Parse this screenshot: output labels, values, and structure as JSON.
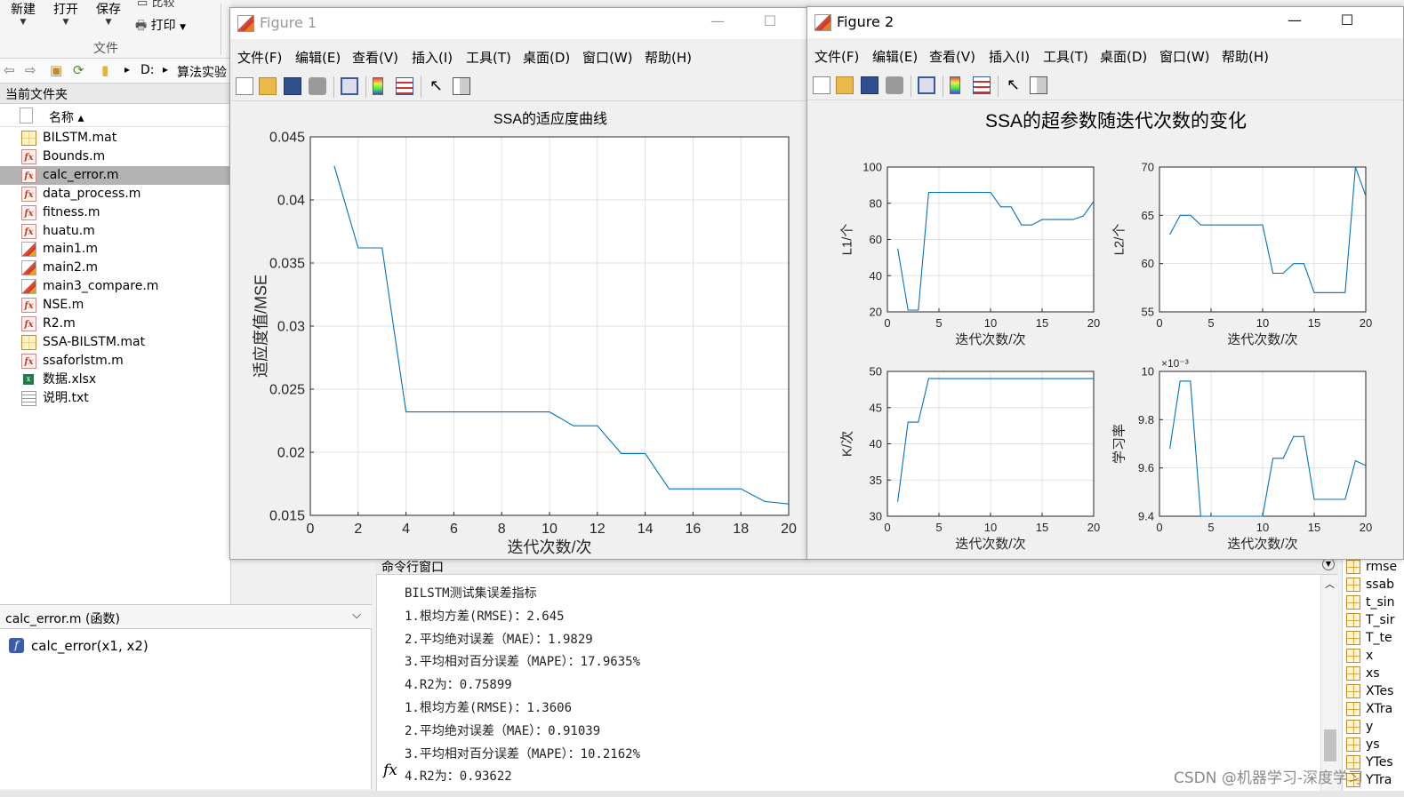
{
  "toolstrip": {
    "new_label": "新建",
    "open_label": "打开",
    "save_label": "保存",
    "compare_label": "比较",
    "print_label": "打印",
    "file_group_label": "文件"
  },
  "address": {
    "drive": "D:",
    "folder": "算法实验"
  },
  "current_folder": {
    "header": "当前文件夹",
    "name_col": "名称 ▴",
    "files": [
      {
        "name": "BILSTM.mat",
        "type": "mat"
      },
      {
        "name": "Bounds.m",
        "type": "m"
      },
      {
        "name": "calc_error.m",
        "type": "m",
        "selected": true
      },
      {
        "name": "data_process.m",
        "type": "m"
      },
      {
        "name": "fitness.m",
        "type": "m"
      },
      {
        "name": "huatu.m",
        "type": "m"
      },
      {
        "name": "main1.m",
        "type": "ml"
      },
      {
        "name": "main2.m",
        "type": "ml"
      },
      {
        "name": "main3_compare.m",
        "type": "ml"
      },
      {
        "name": "NSE.m",
        "type": "m"
      },
      {
        "name": "R2.m",
        "type": "m"
      },
      {
        "name": "SSA-BILSTM.mat",
        "type": "mat"
      },
      {
        "name": "ssaforlstm.m",
        "type": "m"
      },
      {
        "name": "数据.xlsx",
        "type": "xls"
      },
      {
        "name": "说明.txt",
        "type": "txt"
      }
    ]
  },
  "details": {
    "header": "calc_error.m  (函数)",
    "signature": "calc_error(x1, x2)"
  },
  "command_window": {
    "header": "命令行窗口",
    "lines": [
      "BILSTM测试集误差指标",
      "1.根均方差(RMSE)：2.645",
      "2.平均绝对误差（MAE）：1.9829",
      "3.平均相对百分误差（MAPE）：17.9635%",
      "4.R2为：0.75899",
      "1.根均方差(RMSE)：1.3606",
      "2.平均绝对误差（MAE）：0.91039",
      "3.平均相对百分误差（MAPE）：10.2162%",
      "4.R2为：0.93622"
    ],
    "prompt_icon": "fx"
  },
  "workspace": {
    "vars": [
      "rmse",
      "ssab",
      "t_sin",
      "T_sir",
      "T_te",
      "x",
      "xs",
      "XTes",
      "XTra",
      "y",
      "ys",
      "YTes",
      "YTra"
    ]
  },
  "watermark": "CSDN @机器学习-深度学习",
  "figure1": {
    "title": "Figure 1",
    "menus": [
      "文件(F)",
      "编辑(E)",
      "查看(V)",
      "插入(I)",
      "工具(T)",
      "桌面(D)",
      "窗口(W)",
      "帮助(H)"
    ]
  },
  "figure2": {
    "title": "Figure 2",
    "menus": [
      "文件(F)",
      "编辑(E)",
      "查看(V)",
      "插入(I)",
      "工具(T)",
      "桌面(D)",
      "窗口(W)",
      "帮助(H)"
    ],
    "suptitle": "SSA的超参数随迭代次数的变化"
  },
  "chart_data": [
    {
      "type": "line",
      "title": "SSA的适应度曲线",
      "xlabel": "迭代次数/次",
      "ylabel": "适应度值/MSE",
      "xlim": [
        0,
        20
      ],
      "ylim": [
        0.015,
        0.045
      ],
      "xticks": [
        "0",
        "2",
        "4",
        "6",
        "8",
        "10",
        "12",
        "14",
        "16",
        "18",
        "20"
      ],
      "yticks": [
        "0.015",
        "0.02",
        "0.025",
        "0.03",
        "0.035",
        "0.04",
        "0.045"
      ],
      "grid": true,
      "x": [
        1,
        2,
        3,
        4,
        5,
        6,
        7,
        8,
        9,
        10,
        11,
        12,
        13,
        14,
        15,
        16,
        17,
        18,
        19,
        20
      ],
      "y": [
        0.0427,
        0.0362,
        0.0362,
        0.0232,
        0.0232,
        0.0232,
        0.0232,
        0.0232,
        0.0232,
        0.0232,
        0.0221,
        0.0221,
        0.0199,
        0.0199,
        0.0171,
        0.0171,
        0.0171,
        0.0171,
        0.0161,
        0.0159
      ]
    },
    {
      "type": "line",
      "title": "",
      "xlabel": "迭代次数/次",
      "ylabel": "L1/个",
      "xlim": [
        0,
        20
      ],
      "ylim": [
        20,
        100
      ],
      "xticks": [
        "0",
        "5",
        "10",
        "15",
        "20"
      ],
      "yticks": [
        "20",
        "40",
        "60",
        "80",
        "100"
      ],
      "grid": true,
      "x": [
        1,
        2,
        3,
        4,
        5,
        6,
        7,
        8,
        9,
        10,
        11,
        12,
        13,
        14,
        15,
        16,
        17,
        18,
        19,
        20
      ],
      "y": [
        55,
        21,
        21,
        86,
        86,
        86,
        86,
        86,
        86,
        86,
        78,
        78,
        68,
        68,
        71,
        71,
        71,
        71,
        73,
        81
      ]
    },
    {
      "type": "line",
      "title": "",
      "xlabel": "迭代次数/次",
      "ylabel": "L2/个",
      "xlim": [
        0,
        20
      ],
      "ylim": [
        55,
        70
      ],
      "xticks": [
        "0",
        "5",
        "10",
        "15",
        "20"
      ],
      "yticks": [
        "55",
        "60",
        "65",
        "70"
      ],
      "grid": true,
      "x": [
        1,
        2,
        3,
        4,
        5,
        6,
        7,
        8,
        9,
        10,
        11,
        12,
        13,
        14,
        15,
        16,
        17,
        18,
        19,
        20
      ],
      "y": [
        63,
        65,
        65,
        64,
        64,
        64,
        64,
        64,
        64,
        64,
        59,
        59,
        60,
        60,
        57,
        57,
        57,
        57,
        70,
        67
      ]
    },
    {
      "type": "line",
      "title": "",
      "xlabel": "迭代次数/次",
      "ylabel": "K/次",
      "xlim": [
        0,
        20
      ],
      "ylim": [
        30,
        50
      ],
      "xticks": [
        "0",
        "5",
        "10",
        "15",
        "20"
      ],
      "yticks": [
        "30",
        "35",
        "40",
        "45",
        "50"
      ],
      "grid": true,
      "x": [
        1,
        2,
        3,
        4,
        5,
        6,
        7,
        8,
        9,
        10,
        11,
        12,
        13,
        14,
        15,
        16,
        17,
        18,
        19,
        20
      ],
      "y": [
        32,
        43,
        43,
        49,
        49,
        49,
        49,
        49,
        49,
        49,
        49,
        49,
        49,
        49,
        49,
        49,
        49,
        49,
        49,
        49
      ]
    },
    {
      "type": "line",
      "title": "",
      "xlabel": "迭代次数/次",
      "ylabel": "学习率",
      "exponent_label": "×10⁻³",
      "xlim": [
        0,
        20
      ],
      "ylim": [
        9.4,
        10
      ],
      "xticks": [
        "0",
        "5",
        "10",
        "15",
        "20"
      ],
      "yticks": [
        "9.4",
        "9.6",
        "9.8",
        "10"
      ],
      "grid": true,
      "x": [
        1,
        2,
        3,
        4,
        5,
        6,
        7,
        8,
        9,
        10,
        11,
        12,
        13,
        14,
        15,
        16,
        17,
        18,
        19,
        20
      ],
      "y": [
        9.68,
        9.96,
        9.96,
        9.4,
        9.4,
        9.4,
        9.4,
        9.4,
        9.4,
        9.4,
        9.64,
        9.64,
        9.73,
        9.73,
        9.47,
        9.47,
        9.47,
        9.47,
        9.63,
        9.61
      ]
    }
  ]
}
